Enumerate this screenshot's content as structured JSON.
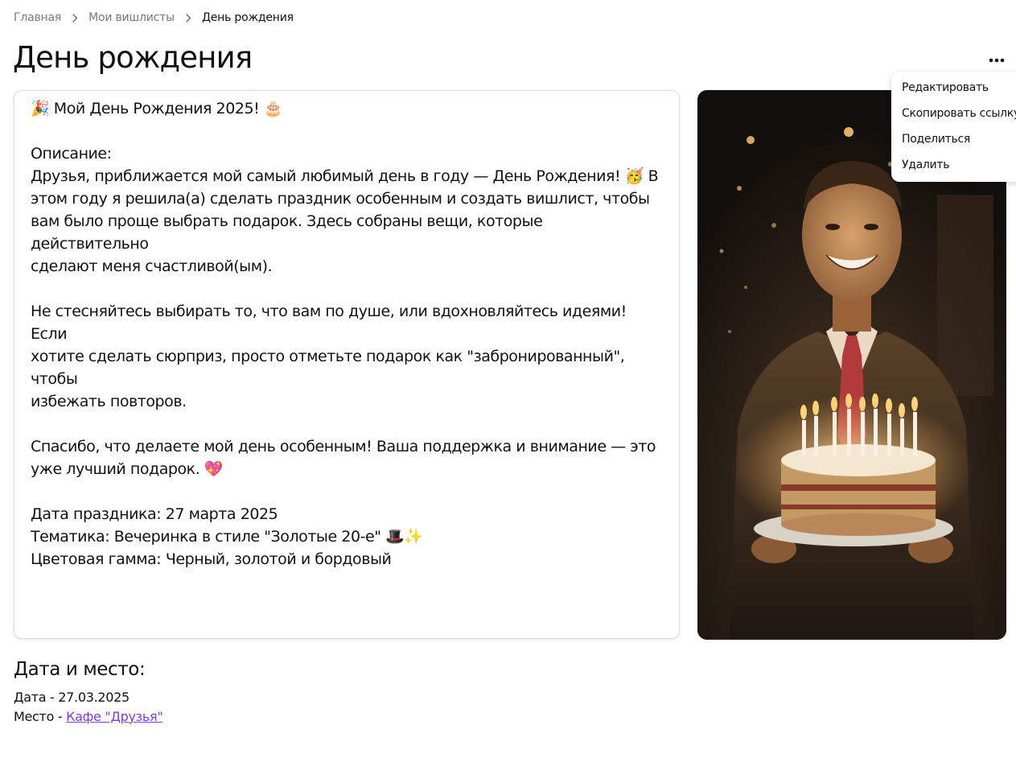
{
  "breadcrumb": {
    "items": [
      "Главная",
      "Мои вишлисты"
    ],
    "current": "День рождения"
  },
  "page": {
    "title": "День рождения"
  },
  "menu": {
    "items": [
      "Редактировать",
      "Скопировать ссылку",
      "Поделиться",
      "Удалить"
    ]
  },
  "description": {
    "lines": [
      "🎉 Мой День Рождения 2025! 🎂",
      "",
      "Описание:",
      "Друзья, приближается мой самый любимый день в году — День Рождения! 🥳 В",
      "этом году я решила(а) сделать праздник особенным и создать вишлист, чтобы",
      "вам было проще выбрать подарок. Здесь собраны вещи, которые действительно",
      "сделают меня счастливой(ым).",
      "",
      "Не стесняйтесь выбирать то, что вам по душе, или вдохновляйтесь идеями! Если",
      "хотите сделать сюрприз, просто отметьте подарок как \"забронированный\", чтобы",
      "избежать повторов.",
      "",
      "Спасибо, что делаете мой день особенным! Ваша поддержка и внимание — это",
      "уже лучший подарок. 💖",
      "",
      "Дата праздника: 27 марта 2025",
      "Тематика: Вечеринка в стиле \"Золотые 20-е\" 🎩✨",
      "Цветовая гамма: Черный, золотой и бордовый"
    ]
  },
  "event": {
    "section_title": "Дата и место:",
    "date_label": "Дата - ",
    "date_value": "27.03.2025",
    "place_label": "Место - ",
    "place_link": "Кафе \"Друзья\""
  },
  "icons": {
    "more": "more-horizontal-icon",
    "separator": "chevron-right-icon"
  },
  "colors": {
    "link": "#7c3aed",
    "muted": "#7a7a7a",
    "text": "#111111"
  }
}
